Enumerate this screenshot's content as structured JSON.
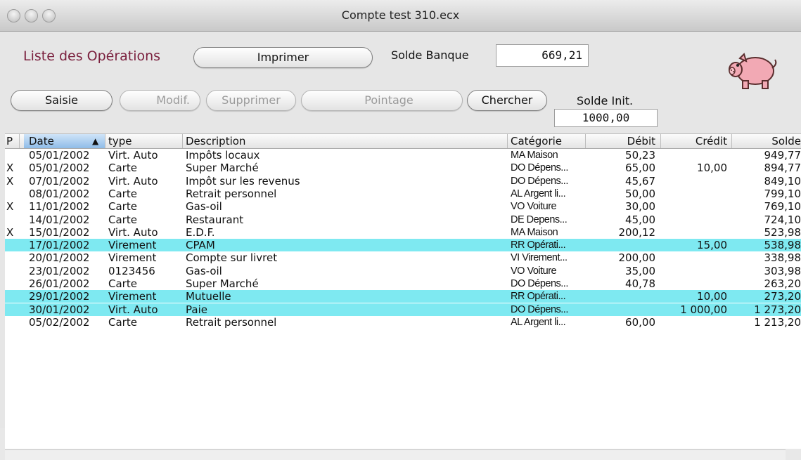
{
  "window": {
    "title": "Compte test 310.ecx"
  },
  "header": {
    "heading": "Liste des Opérations",
    "print_label": "Imprimer",
    "bank_balance_label": "Solde Banque",
    "bank_balance_value": "669,21",
    "initial_balance_label": "Solde Init.",
    "initial_balance_value": "1000,00"
  },
  "toolbar": {
    "entry_label": "Saisie",
    "modify_label": "Modif.",
    "delete_label": "Supprimer",
    "reconcile_label": "Pointage",
    "search_label": "Chercher"
  },
  "table": {
    "columns": {
      "p": "P",
      "date": "Date",
      "type": "type",
      "description": "Description",
      "category": "Catégorie",
      "debit": "Débit",
      "credit": "Crédit",
      "balance": "Solde"
    },
    "sort_indicator": "▲",
    "highlight_color": "#7ee9f1",
    "rows": [
      {
        "p": "",
        "date": "05/01/2002",
        "type": "Virt. Auto",
        "description": "Impôts locaux",
        "category": "MA Maison",
        "debit": "50,23",
        "credit": "",
        "balance": "949,77",
        "highlighted": false
      },
      {
        "p": "X",
        "date": "05/01/2002",
        "type": "Carte",
        "description": "Super Marché",
        "category": "DO Dépens...",
        "debit": "65,00",
        "credit": "10,00",
        "balance": "894,77",
        "highlighted": false
      },
      {
        "p": "X",
        "date": "07/01/2002",
        "type": "Virt. Auto",
        "description": "Impôt sur les revenus",
        "category": "DO Dépens...",
        "debit": "45,67",
        "credit": "",
        "balance": "849,10",
        "highlighted": false
      },
      {
        "p": "",
        "date": "08/01/2002",
        "type": "Carte",
        "description": "Retrait personnel",
        "category": "AL Argent li...",
        "debit": "50,00",
        "credit": "",
        "balance": "799,10",
        "highlighted": false
      },
      {
        "p": "X",
        "date": "11/01/2002",
        "type": "Carte",
        "description": "Gas-oil",
        "category": "VO Voiture",
        "debit": "30,00",
        "credit": "",
        "balance": "769,10",
        "highlighted": false
      },
      {
        "p": "",
        "date": "14/01/2002",
        "type": "Carte",
        "description": "Restaurant",
        "category": "DE Depens...",
        "debit": "45,00",
        "credit": "",
        "balance": "724,10",
        "highlighted": false
      },
      {
        "p": "X",
        "date": "15/01/2002",
        "type": "Virt. Auto",
        "description": "E.D.F.",
        "category": "MA Maison",
        "debit": "200,12",
        "credit": "",
        "balance": "523,98",
        "highlighted": false
      },
      {
        "p": "",
        "date": "17/01/2002",
        "type": "Virement",
        "description": "CPAM",
        "category": "RR Opérati...",
        "debit": "",
        "credit": "15,00",
        "balance": "538,98",
        "highlighted": true
      },
      {
        "p": "",
        "date": "20/01/2002",
        "type": "Virement",
        "description": "Compte sur livret",
        "category": "VI Virement...",
        "debit": "200,00",
        "credit": "",
        "balance": "338,98",
        "highlighted": false
      },
      {
        "p": "",
        "date": "23/01/2002",
        "type": "0123456",
        "description": "Gas-oil",
        "category": "VO Voiture",
        "debit": "35,00",
        "credit": "",
        "balance": "303,98",
        "highlighted": false
      },
      {
        "p": "",
        "date": "26/01/2002",
        "type": "Carte",
        "description": "Super Marché",
        "category": "DO Dépens...",
        "debit": "40,78",
        "credit": "",
        "balance": "263,20",
        "highlighted": false
      },
      {
        "p": "",
        "date": "29/01/2002",
        "type": "Virement",
        "description": "Mutuelle",
        "category": "RR Opérati...",
        "debit": "",
        "credit": "10,00",
        "balance": "273,20",
        "highlighted": true
      },
      {
        "p": "",
        "date": "30/01/2002",
        "type": "Virt. Auto",
        "description": "Paie",
        "category": "DO Dépens...",
        "debit": "",
        "credit": "1 000,00",
        "balance": "1 273,20",
        "highlighted": true
      },
      {
        "p": "",
        "date": "05/02/2002",
        "type": "Carte",
        "description": "Retrait personnel",
        "category": "AL Argent li...",
        "debit": "60,00",
        "credit": "",
        "balance": "1 213,20",
        "highlighted": false
      }
    ]
  },
  "colors": {
    "heading": "#7a1f3d",
    "pig": "#f2a9b4"
  },
  "icons": {
    "logo": "piggy-bank-icon",
    "sort": "sort-ascending-icon"
  }
}
